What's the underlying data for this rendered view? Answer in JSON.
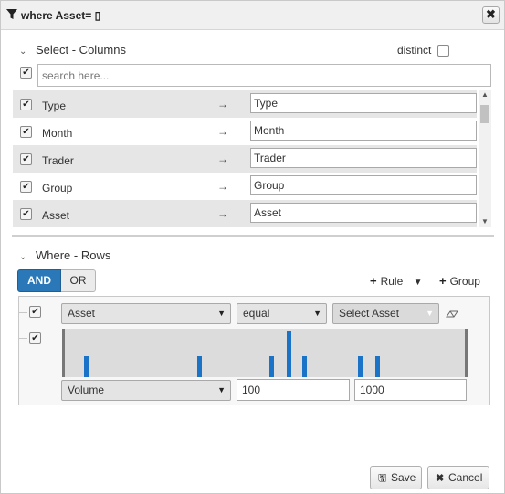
{
  "title": {
    "text": "where Asset= ▯",
    "close_label": "✖"
  },
  "select_section": {
    "heading": "Select - Columns",
    "distinct_label": "distinct",
    "distinct_checked": false,
    "select_all_checked": true,
    "search_placeholder": "search here...",
    "arrow_glyph": "→",
    "columns": [
      {
        "name": "Type",
        "alias": "Type",
        "checked": true
      },
      {
        "name": "Month",
        "alias": "Month",
        "checked": true
      },
      {
        "name": "Trader",
        "alias": "Trader",
        "checked": true
      },
      {
        "name": "Group",
        "alias": "Group",
        "checked": true
      },
      {
        "name": "Asset",
        "alias": "Asset",
        "checked": true
      }
    ]
  },
  "where_section": {
    "heading": "Where - Rows",
    "and_label": "AND",
    "or_label": "OR",
    "active_condition": "AND",
    "add_rule_label": "Rule",
    "add_group_label": "Group",
    "rules": [
      {
        "checked": true,
        "field": "Asset",
        "operator": "equal",
        "value_placeholder": "Select Asset"
      },
      {
        "checked": true,
        "field": "Volume",
        "min": "100",
        "max": "1000",
        "histogram": [
          0.45,
          0.45,
          0.45,
          1.0,
          0.45,
          0.45,
          0.45
        ]
      }
    ]
  },
  "footer": {
    "save_label": "Save",
    "cancel_label": "Cancel"
  },
  "colors": {
    "accent": "#2a78b8",
    "histogram_bar": "#1a73c7"
  }
}
